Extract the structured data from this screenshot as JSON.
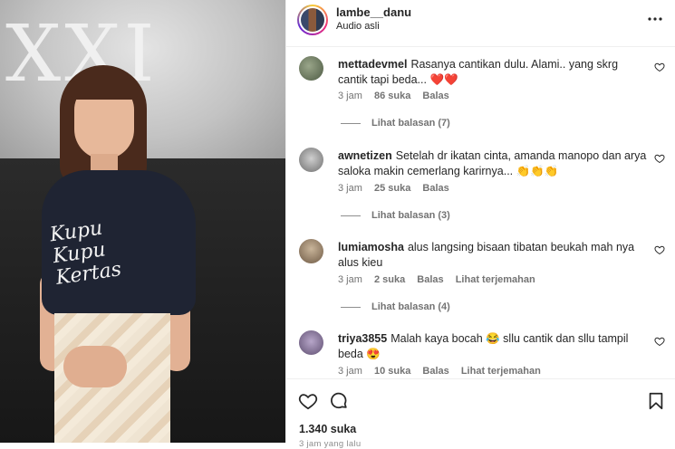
{
  "post": {
    "username": "lambe__danu",
    "subtitle": "Audio asli",
    "photo_text": "XXI",
    "shirt_text": "Kupu Kupu Kertas"
  },
  "comments": [
    {
      "user": "mettadevmel",
      "text": "Rasanya cantikan dulu. Alami.. yang skrg cantik tapi beda... ❤️❤️",
      "time": "3 jam",
      "likes": "86 suka",
      "reply": "Balas",
      "translate": "",
      "replies_label": "Lihat balasan (7)",
      "avatar_color": "#6b7a5e"
    },
    {
      "user": "awnetizen",
      "text": "Setelah dr ikatan cinta, amanda manopo dan arya saloka makin cemerlang karirnya... 👏👏👏",
      "time": "3 jam",
      "likes": "25 suka",
      "reply": "Balas",
      "translate": "",
      "replies_label": "Lihat balasan (3)",
      "avatar_color": "#8a8a8a"
    },
    {
      "user": "lumiamosha",
      "text": "alus langsing bisaan tibatan beukah mah nya alus kieu",
      "time": "3 jam",
      "likes": "2 suka",
      "reply": "Balas",
      "translate": "Lihat terjemahan",
      "replies_label": "Lihat balasan (4)",
      "avatar_color": "#9b7b5e"
    },
    {
      "user": "triya3855",
      "text": "Malah kaya bocah 😂 sllu cantik dan sllu tampil beda 😍",
      "time": "3 jam",
      "likes": "10 suka",
      "reply": "Balas",
      "translate": "Lihat terjemahan",
      "replies_label": "",
      "avatar_color": "#7d6f8a"
    }
  ],
  "footer": {
    "likes": "1.340 suka",
    "time": "3 jam yang lalu"
  },
  "icons": [
    "more-icon",
    "heart-icon",
    "comment-icon",
    "bookmark-icon"
  ]
}
